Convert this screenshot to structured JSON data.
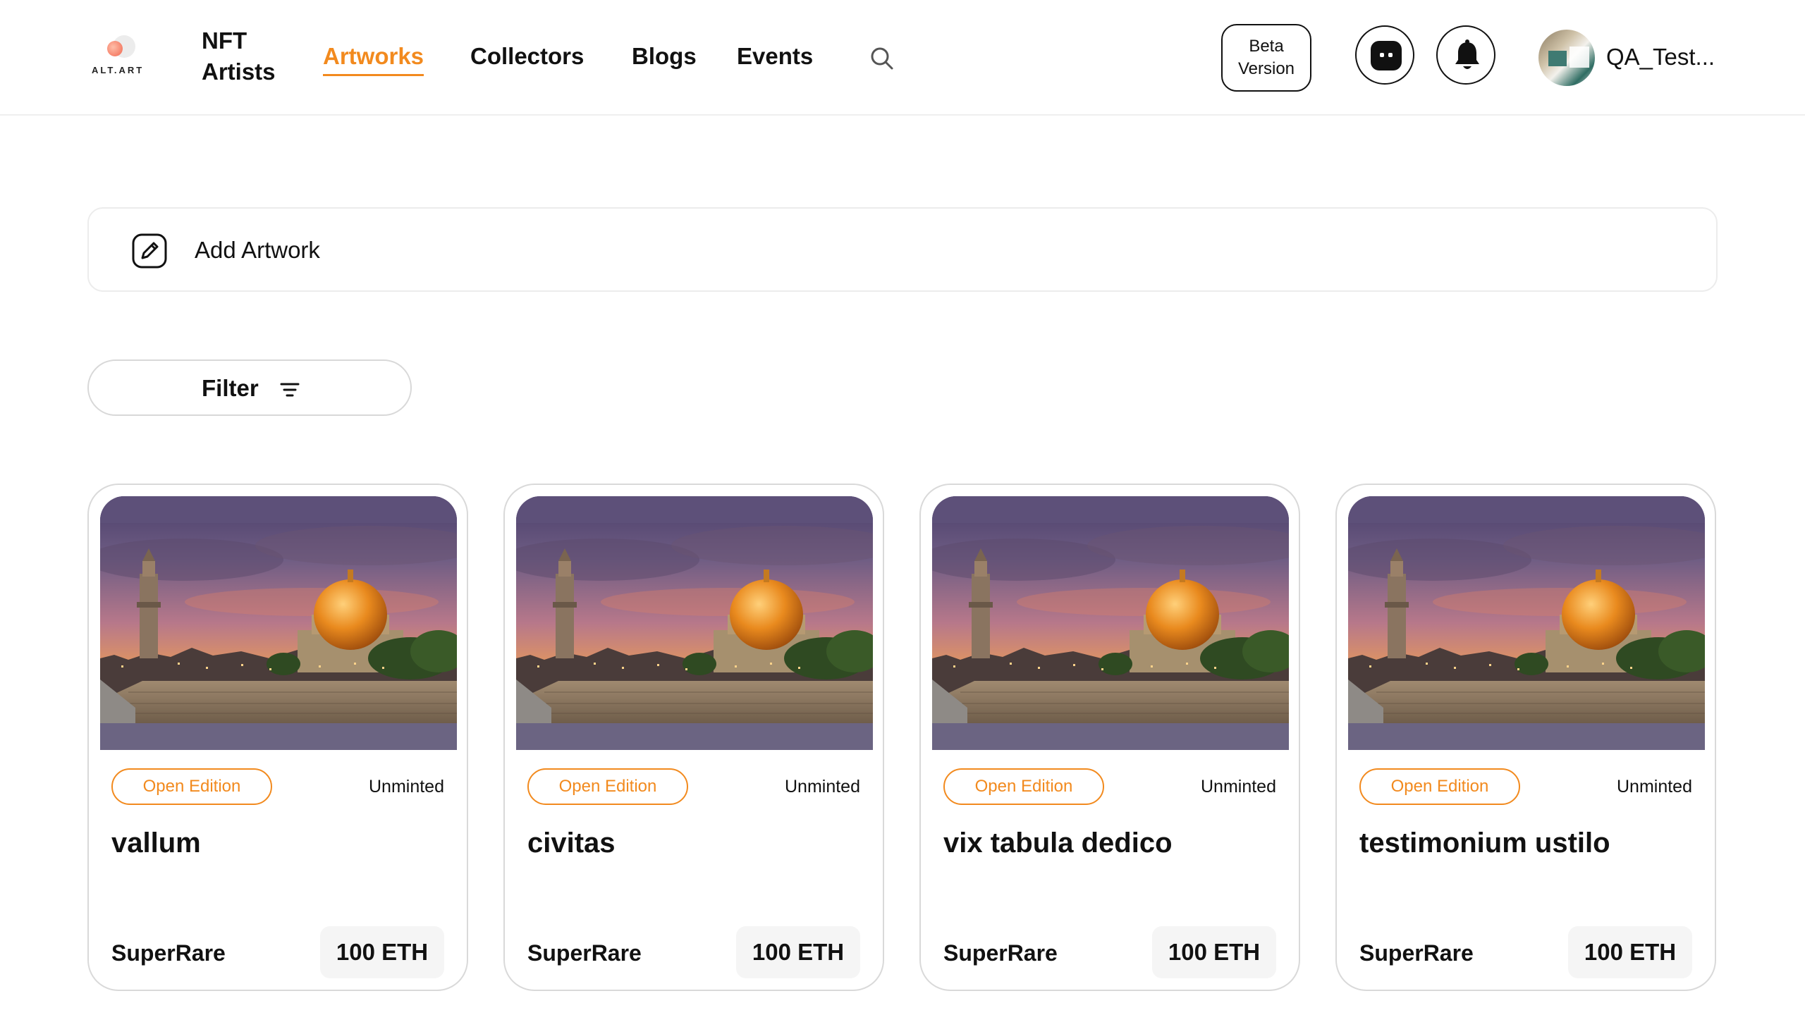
{
  "brand": {
    "logo_text": "ALT.ART"
  },
  "nav": {
    "nft_artists_line1": "NFT",
    "nft_artists_line2": "Artists",
    "artworks": "Artworks",
    "collectors": "Collectors",
    "blogs": "Blogs",
    "events": "Events",
    "active": "Artworks",
    "search_icon": "search-icon"
  },
  "header": {
    "beta_line1": "Beta",
    "beta_line2": "Version",
    "chat_icon": "chat-icon",
    "bell_icon": "bell-icon",
    "username": "QA_Test..."
  },
  "add_artwork": {
    "label": "Add Artwork",
    "icon": "edit-icon"
  },
  "filter": {
    "label": "Filter",
    "icon": "filter-icon"
  },
  "colors": {
    "accent": "#f28a1e",
    "border": "#d9d9d9"
  },
  "artworks": [
    {
      "badge": "Open Edition",
      "status": "Unminted",
      "title": "vallum",
      "platform": "SuperRare",
      "price": "100 ETH"
    },
    {
      "badge": "Open Edition",
      "status": "Unminted",
      "title": "civitas",
      "platform": "SuperRare",
      "price": "100 ETH"
    },
    {
      "badge": "Open Edition",
      "status": "Unminted",
      "title": "vix tabula dedico",
      "platform": "SuperRare",
      "price": "100 ETH"
    },
    {
      "badge": "Open Edition",
      "status": "Unminted",
      "title": "testimonium ustilo",
      "platform": "SuperRare",
      "price": "100 ETH"
    }
  ]
}
